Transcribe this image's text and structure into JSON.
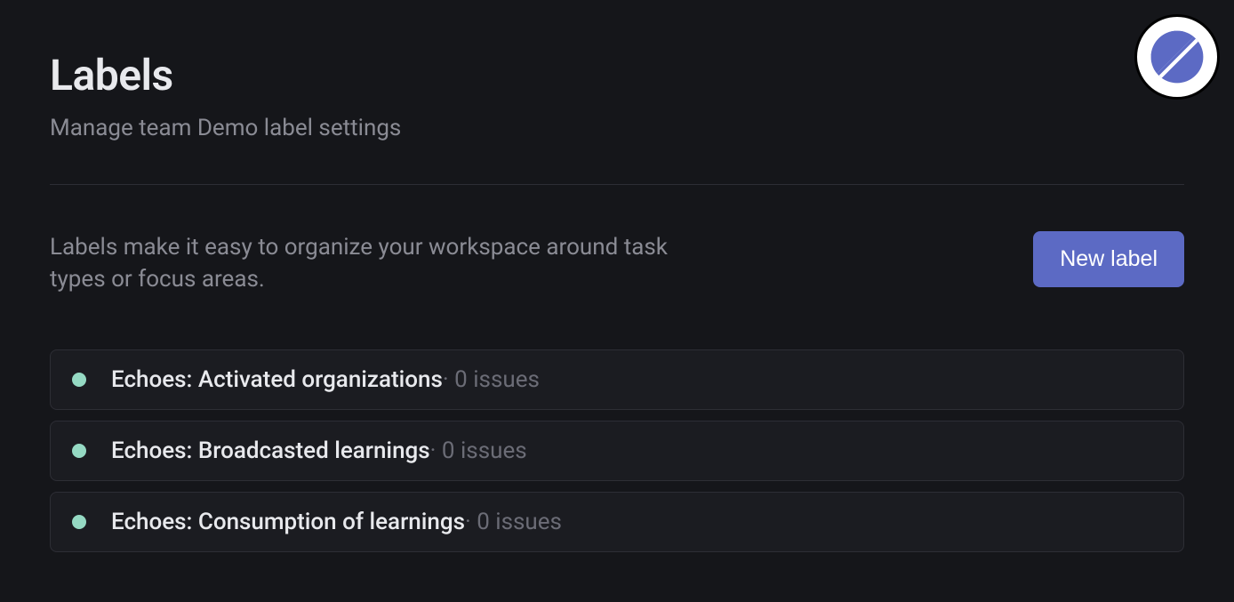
{
  "header": {
    "title": "Labels",
    "subtitle": "Manage team Demo label settings"
  },
  "description": "Labels make it easy to organize your workspace around task types or focus areas.",
  "actions": {
    "new_label": "New label"
  },
  "labels": [
    {
      "name": "Echoes: Activated organizations",
      "color": "#95d9c3",
      "issue_count": 0,
      "meta": " · 0 issues"
    },
    {
      "name": "Echoes: Broadcasted learnings",
      "color": "#95d9c3",
      "issue_count": 0,
      "meta": " · 0 issues"
    },
    {
      "name": "Echoes: Consumption of learnings",
      "color": "#95d9c3",
      "issue_count": 0,
      "meta": " · 0 issues"
    }
  ],
  "colors": {
    "label_dot": "#95d9c3"
  }
}
